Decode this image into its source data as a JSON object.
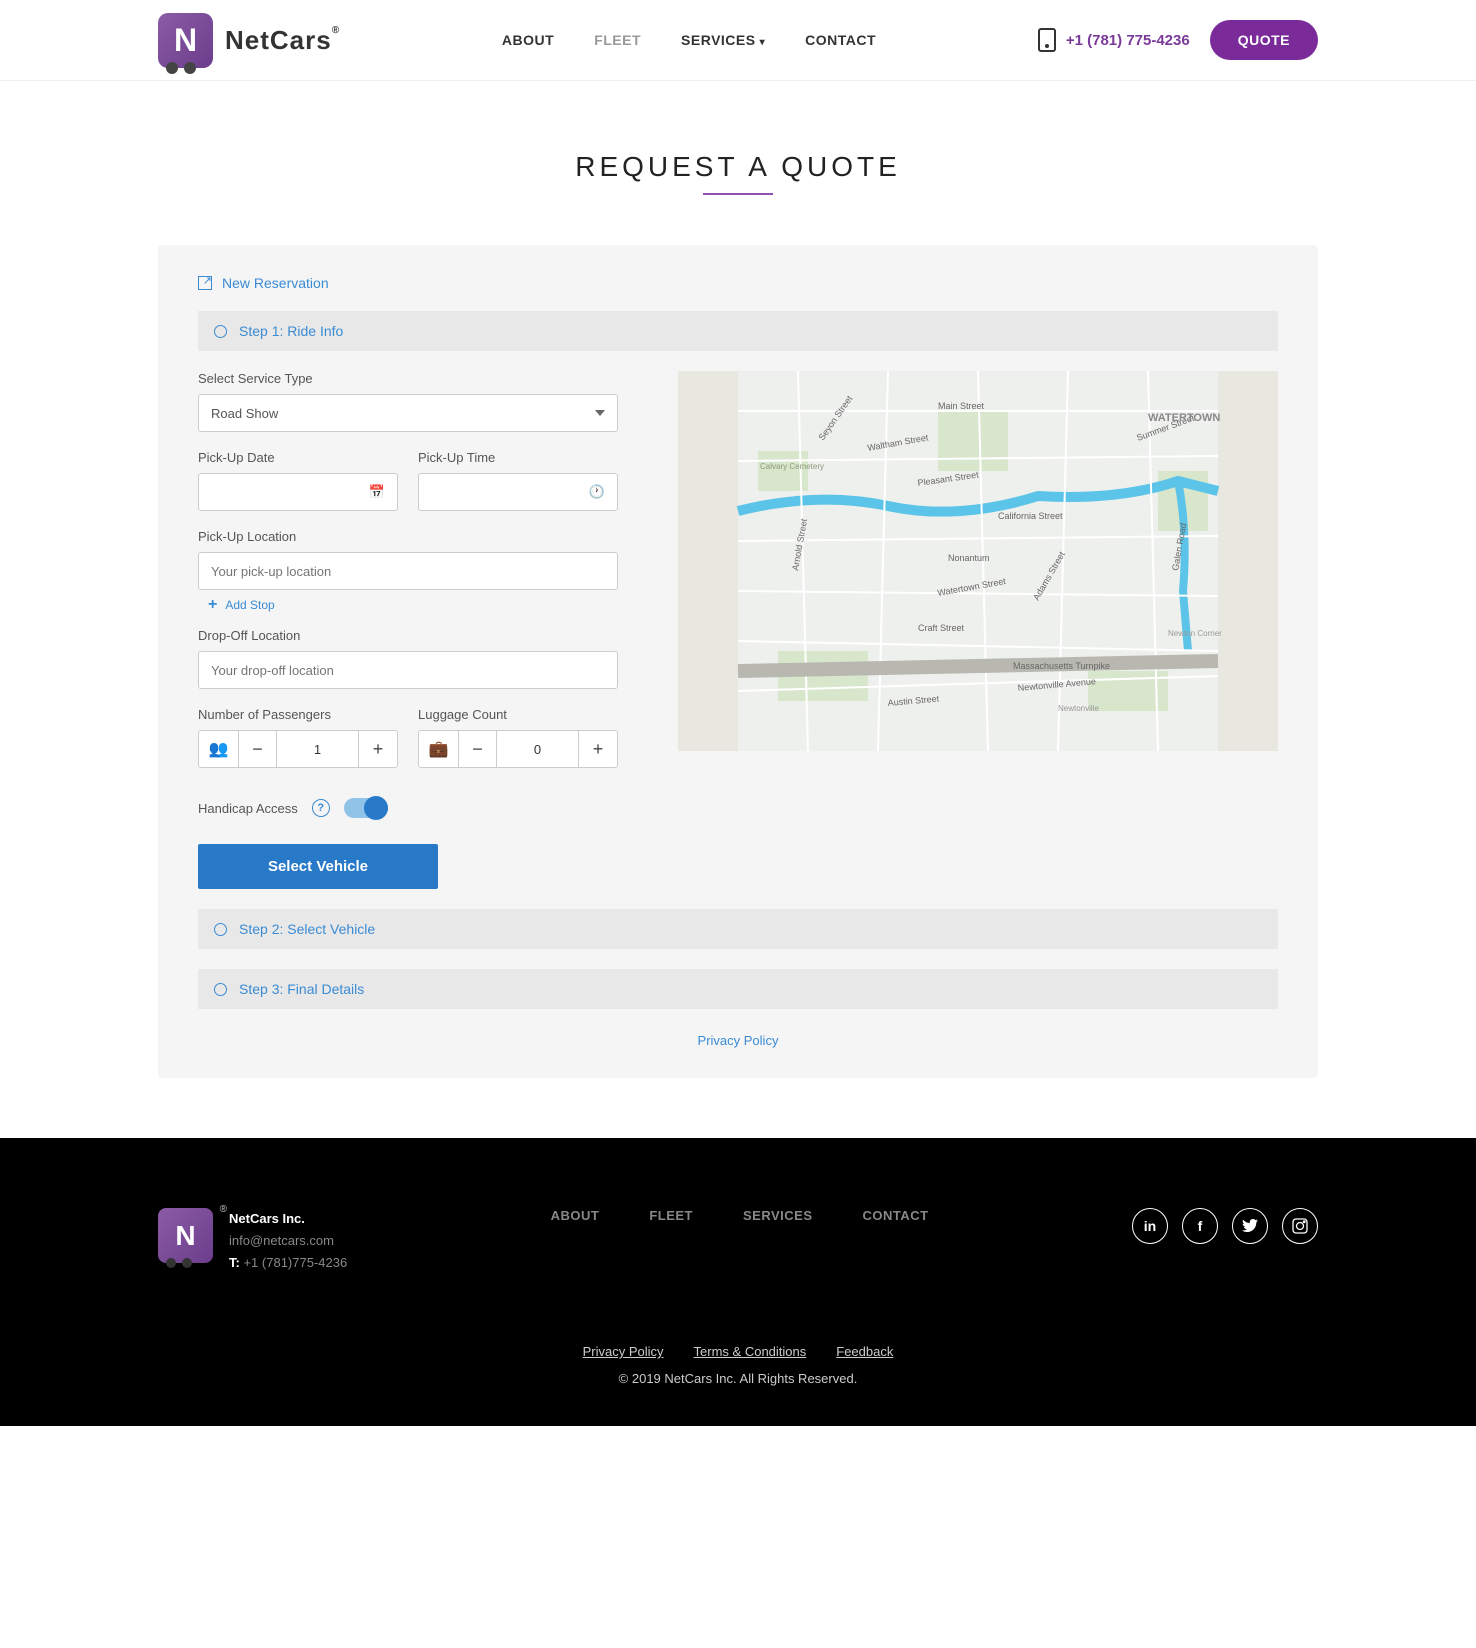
{
  "brand": {
    "name": "NetCars",
    "reg": "®"
  },
  "nav": {
    "about": "ABOUT",
    "fleet": "FLEET",
    "services": "SERVICES",
    "contact": "CONTACT",
    "phone": "+1 (781) 775-4236",
    "quote": "QUOTE"
  },
  "page": {
    "title": "REQUEST A QUOTE"
  },
  "form": {
    "new_reservation": "New Reservation",
    "step1": "Step 1: Ride Info",
    "step2": "Step 2: Select Vehicle",
    "step3": "Step 3: Final Details",
    "service_type": {
      "label": "Select Service Type",
      "value": "Road Show"
    },
    "pickup_date": {
      "label": "Pick-Up Date",
      "value": ""
    },
    "pickup_time": {
      "label": "Pick-Up Time",
      "value": ""
    },
    "pickup_loc": {
      "label": "Pick-Up Location",
      "placeholder": "Your pick-up location"
    },
    "add_stop": "Add Stop",
    "dropoff_loc": {
      "label": "Drop-Off Location",
      "placeholder": "Your drop-off location"
    },
    "passengers": {
      "label": "Number of Passengers",
      "value": "1"
    },
    "luggage": {
      "label": "Luggage Count",
      "value": "0"
    },
    "handicap": {
      "label": "Handicap Access"
    },
    "submit": "Select Vehicle",
    "privacy": "Privacy Policy"
  },
  "map_streets": [
    "Main Street",
    "Waltham Street",
    "Seyon Street",
    "Pleasant Street",
    "California Street",
    "Nonantum",
    "Watertown Street",
    "Adams Street",
    "Craft Street",
    "Massachusetts Turnpike",
    "Newtonville Avenue",
    "Arnold Street",
    "Galen Road",
    "Summer Street",
    "Calvary Cemetery",
    "Newtonville",
    "Newton Corner",
    "WATERTOWN",
    "Austin Street"
  ],
  "footer": {
    "company": "NetCars Inc.",
    "email": "info@netcars.com",
    "tel_label": "T:",
    "tel": "+1 (781)775-4236",
    "nav": {
      "about": "ABOUT",
      "fleet": "FLEET",
      "services": "SERVICES",
      "contact": "CONTACT"
    },
    "legal": {
      "priv": "Privacy Policy",
      "terms": "Terms & Conditions",
      "feedback": "Feedback"
    },
    "copy": "© 2019 NetCars Inc. All Rights Reserved."
  }
}
